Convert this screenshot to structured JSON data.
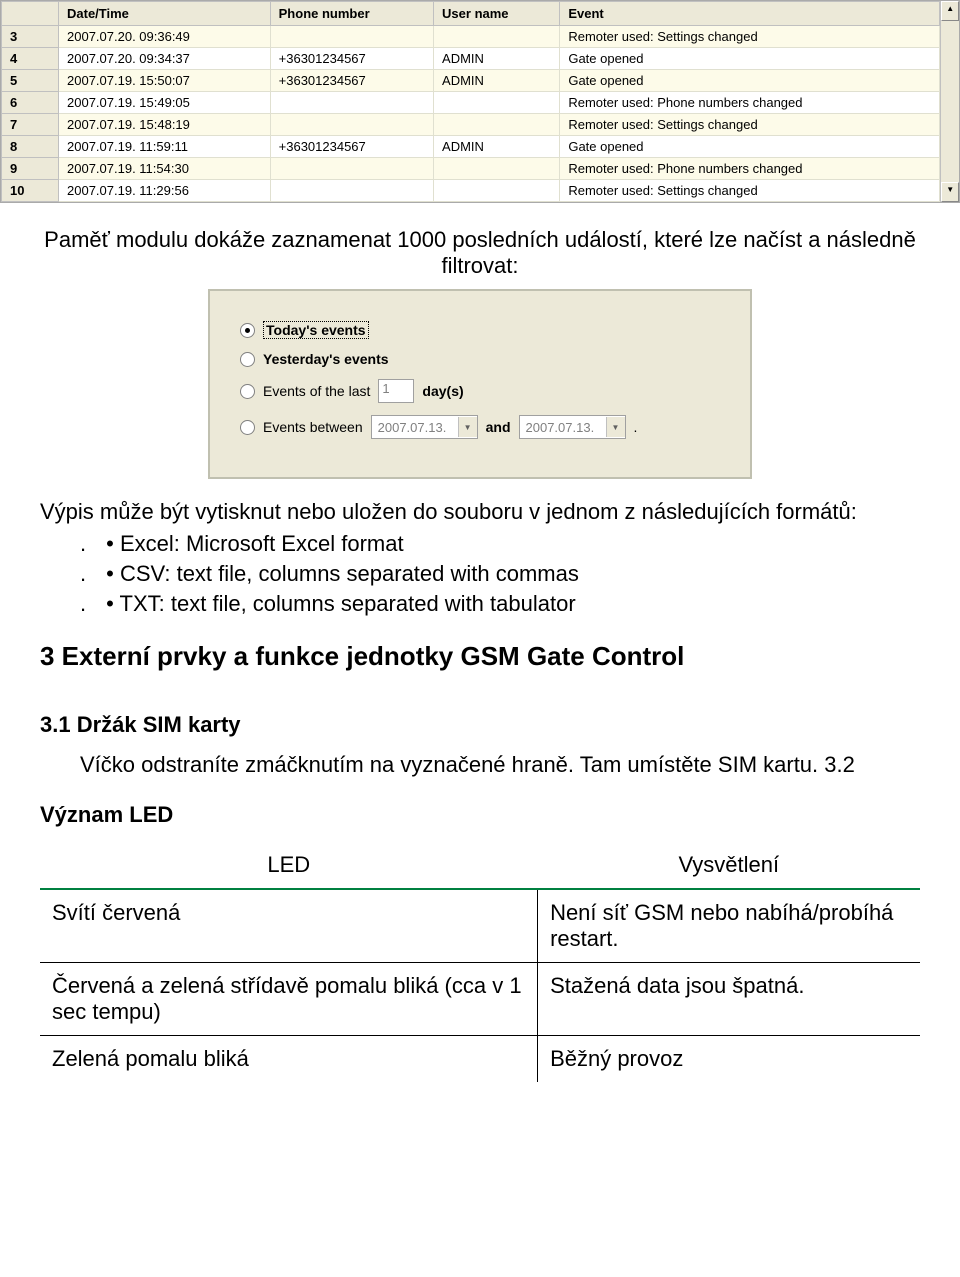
{
  "events": {
    "headers": {
      "rownum": "",
      "datetime": "Date/Time",
      "phone": "Phone number",
      "user": "User name",
      "event": "Event"
    },
    "rows": [
      {
        "n": "3",
        "dt": "2007.07.20. 09:36:49",
        "phone": "",
        "user": "",
        "event": "Remoter used: Settings changed"
      },
      {
        "n": "4",
        "dt": "2007.07.20. 09:34:37",
        "phone": "+36301234567",
        "user": "ADMIN",
        "event": "Gate opened"
      },
      {
        "n": "5",
        "dt": "2007.07.19. 15:50:07",
        "phone": "+36301234567",
        "user": "ADMIN",
        "event": "Gate opened"
      },
      {
        "n": "6",
        "dt": "2007.07.19. 15:49:05",
        "phone": "",
        "user": "",
        "event": "Remoter used: Phone numbers changed"
      },
      {
        "n": "7",
        "dt": "2007.07.19. 15:48:19",
        "phone": "",
        "user": "",
        "event": "Remoter used: Settings changed"
      },
      {
        "n": "8",
        "dt": "2007.07.19. 11:59:11",
        "phone": "+36301234567",
        "user": "ADMIN",
        "event": "Gate opened"
      },
      {
        "n": "9",
        "dt": "2007.07.19. 11:54:30",
        "phone": "",
        "user": "",
        "event": "Remoter used: Phone numbers changed"
      },
      {
        "n": "10",
        "dt": "2007.07.19. 11:29:56",
        "phone": "",
        "user": "",
        "event": "Remoter used: Settings changed"
      }
    ]
  },
  "para1": "Paměť modulu dokáže zaznamenat 1000 posledních událostí, které lze načíst a následně filtrovat:",
  "filter": {
    "today": "Today's events",
    "yesterday": "Yesterday's events",
    "last_prefix": "Events of the last",
    "days": "1",
    "days_suffix": "day(s)",
    "between_prefix": "Events between",
    "date_from": "2007.07.13.",
    "and": "and",
    "date_to": "2007.07.13.",
    "dot": "."
  },
  "para2": "Výpis může být vytisknut nebo uložen do souboru v jednom z následujících formátů:",
  "formats": [
    "• Excel: Microsoft Excel format",
    "• CSV: text file, columns separated with commas",
    "• TXT: text file, columns separated with tabulator"
  ],
  "section3": "3 Externí prvky a funkce jednotky GSM Gate Control",
  "section31": "3.1 Držák SIM karty",
  "section31_text": "Víčko odstraníte zmáčknutím na vyznačené hraně. Tam umístěte SIM kartu. 3.2",
  "section32": "Význam LED",
  "led": {
    "h1": "LED",
    "h2": "Vysvětlení",
    "rows": [
      {
        "a": "Svítí červená",
        "b": "Není síť GSM nebo nabíhá/probíhá restart."
      },
      {
        "a": "Červená a zelená střídavě pomalu bliká (cca v 1 sec tempu)",
        "b": "Stažená data jsou špatná."
      },
      {
        "a": "Zelená pomalu bliká",
        "b": "Běžný provoz"
      }
    ]
  }
}
